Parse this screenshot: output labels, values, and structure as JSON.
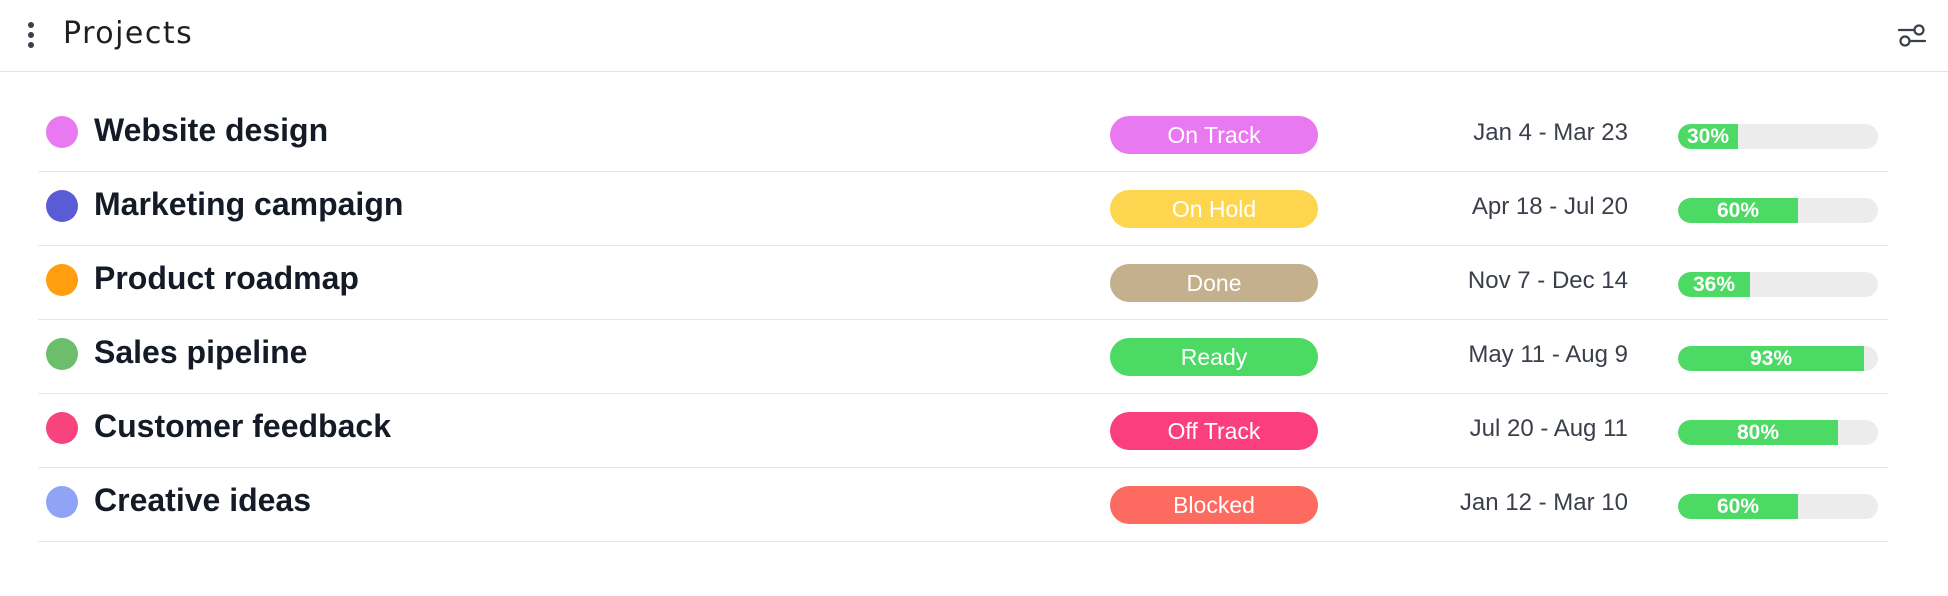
{
  "header": {
    "title": "Projects"
  },
  "projects": [
    {
      "name": "Website design",
      "dot_color": "#e879f0",
      "status": "On Track",
      "status_color": "#e879f0",
      "dates": "Jan 4 - Mar 23",
      "progress": 30,
      "progress_label": "30%"
    },
    {
      "name": "Marketing campaign",
      "dot_color": "#5b5bd6",
      "status": "On Hold",
      "status_color": "#fdd54f",
      "dates": "Apr 18 - Jul 20",
      "progress": 60,
      "progress_label": "60%"
    },
    {
      "name": "Product roadmap",
      "dot_color": "#ff9f0f",
      "status": "Done",
      "status_color": "#c4b08c",
      "dates": "Nov 7 - Dec 14",
      "progress": 36,
      "progress_label": "36%"
    },
    {
      "name": "Sales pipeline",
      "dot_color": "#6cbd6c",
      "status": "Ready",
      "status_color": "#4cd964",
      "dates": "May 11 - Aug 9",
      "progress": 93,
      "progress_label": "93%"
    },
    {
      "name": "Customer feedback",
      "dot_color": "#f7437e",
      "status": "Off Track",
      "status_color": "#fb3f7e",
      "dates": "Jul 20 - Aug 11",
      "progress": 80,
      "progress_label": "80%"
    },
    {
      "name": "Creative ideas",
      "dot_color": "#8fa3f7",
      "status": "Blocked",
      "status_color": "#fd6b60",
      "dates": "Jan 12 - Mar 10",
      "progress": 60,
      "progress_label": "60%"
    }
  ],
  "icons": {
    "menu": "more-vertical-icon",
    "filter": "filter-sliders-icon"
  },
  "colors": {
    "progress_fill": "#4cd964",
    "progress_track": "#ececec"
  }
}
